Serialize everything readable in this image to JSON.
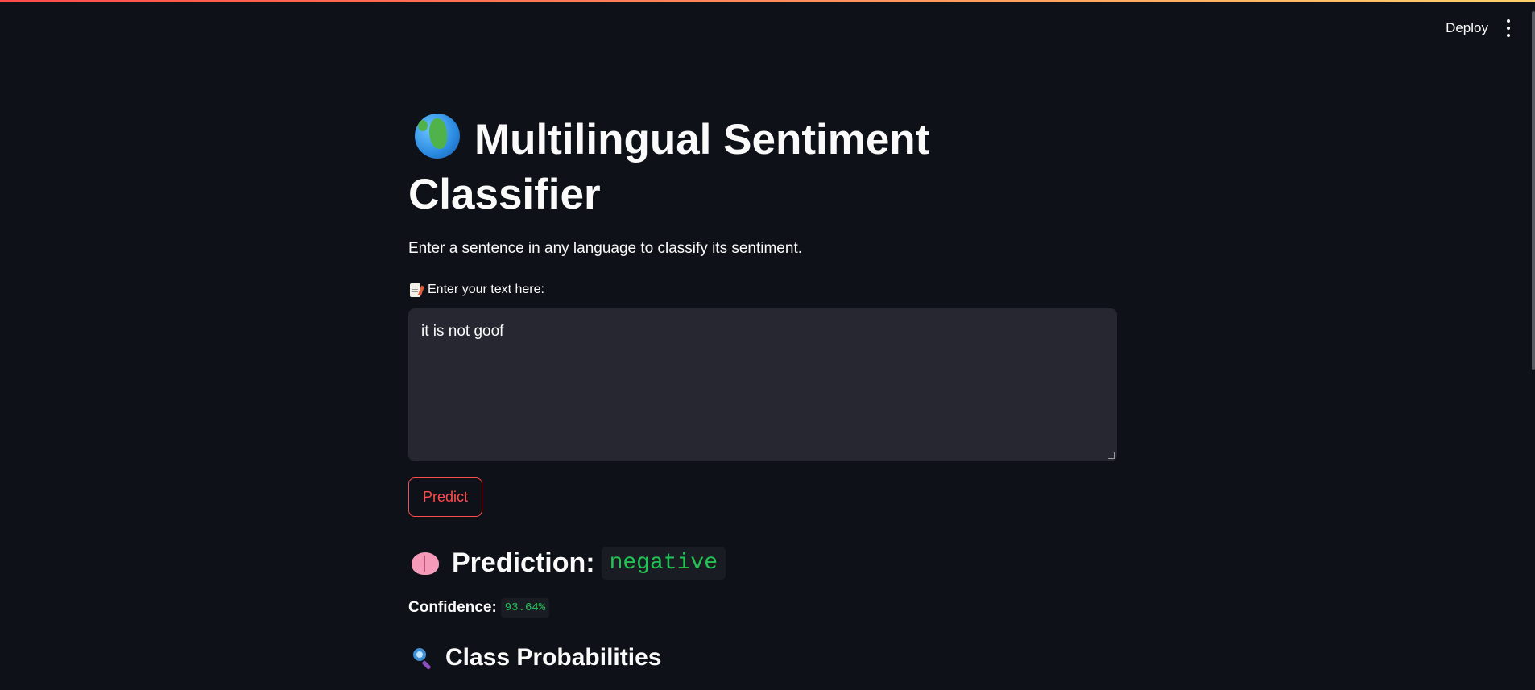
{
  "header": {
    "deploy_label": "Deploy",
    "menu_icon": "kebab-menu-icon"
  },
  "main": {
    "title_icon": "globe-icon",
    "title": "Multilingual Sentiment Classifier",
    "subtitle": "Enter a sentence in any language to classify its sentiment.",
    "input_icon": "memo-icon",
    "input_label": "Enter your text here:",
    "input_value": "it is not goof",
    "predict_label": "Predict",
    "prediction_icon": "brain-icon",
    "prediction_label": "Prediction:",
    "prediction_value": "negative",
    "confidence_label": "Confidence:",
    "confidence_value": "93.64%",
    "probs_icon": "search-icon",
    "probs_title": "Class Probabilities"
  },
  "colors": {
    "background": "#0e1117",
    "accent": "#ff4b4b",
    "code_green": "#21c354",
    "input_bg": "#262730"
  }
}
